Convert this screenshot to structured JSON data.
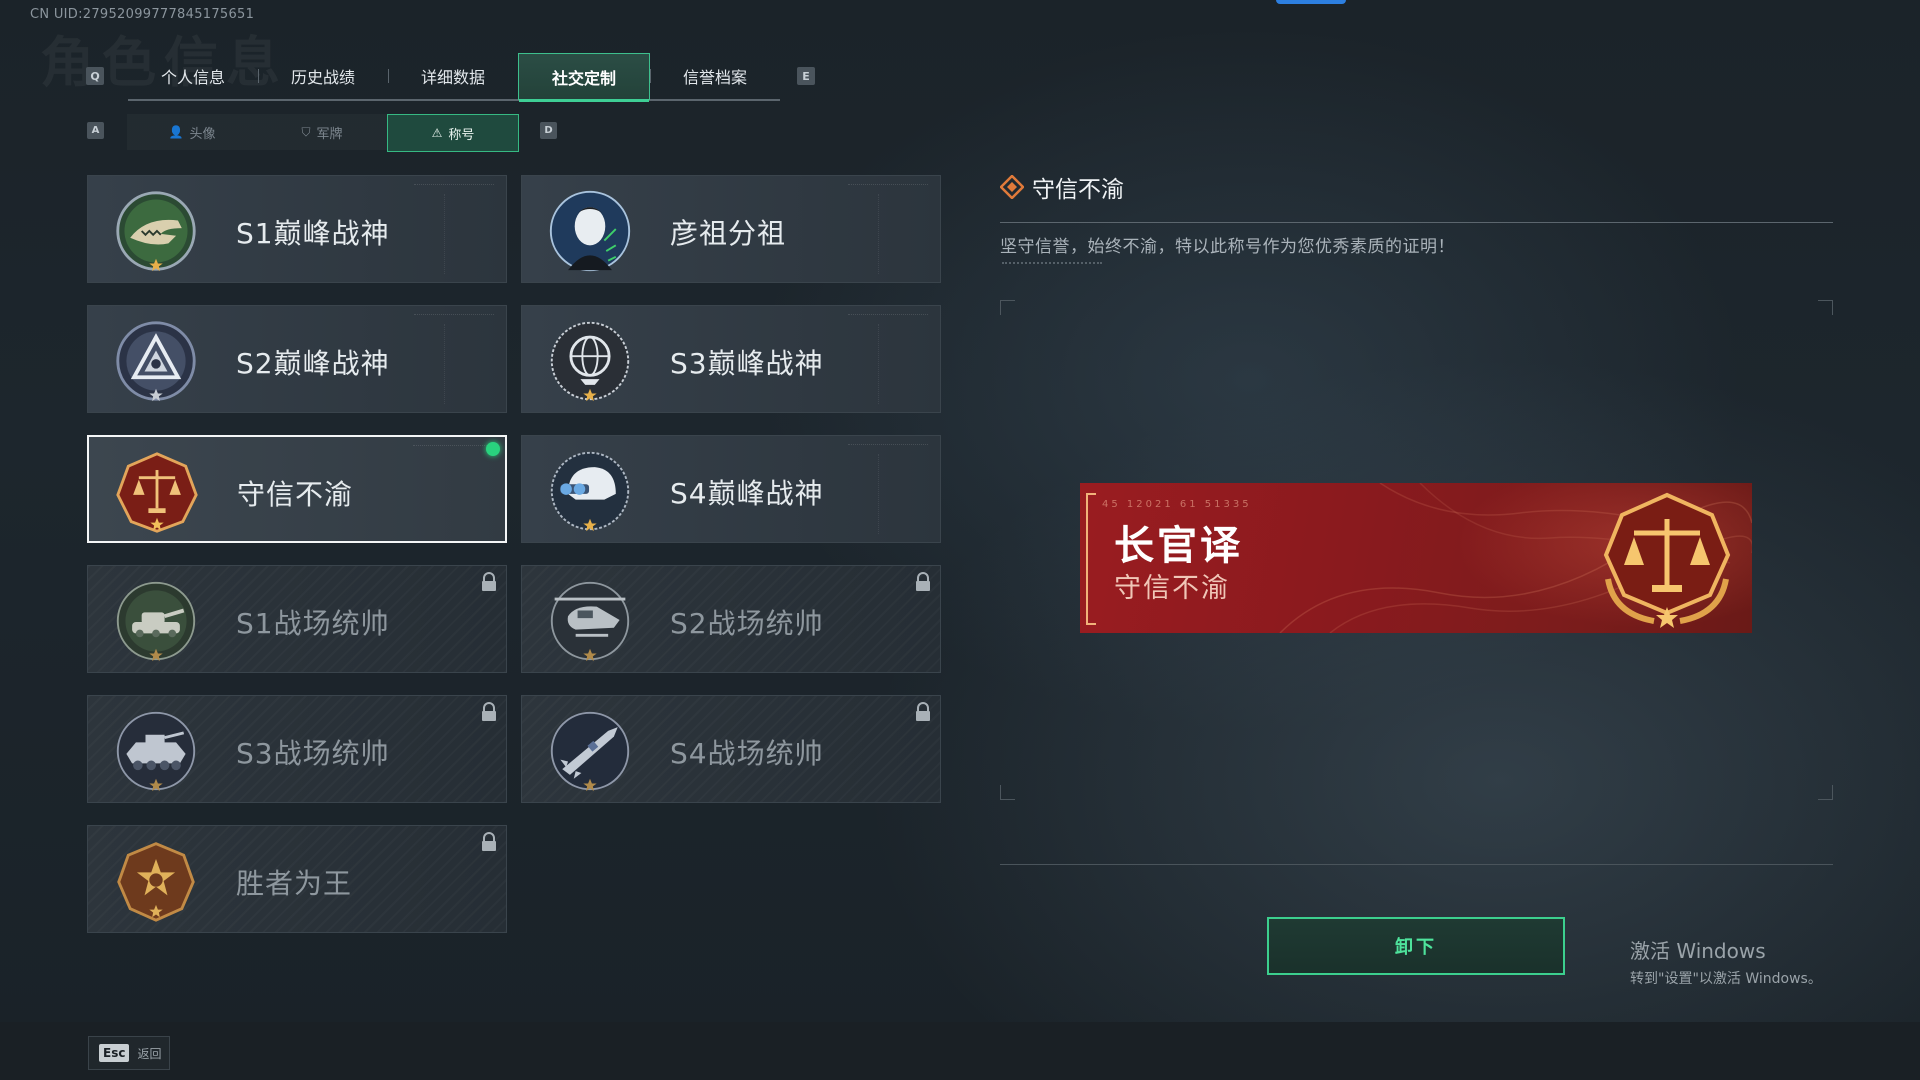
{
  "uid": "CN UID:27952099777845175651",
  "ghost_title": "角色信息",
  "main_tabs": {
    "left_key": "Q",
    "right_key": "E",
    "items": [
      {
        "label": "个人信息"
      },
      {
        "label": "历史战绩"
      },
      {
        "label": "详细数据"
      },
      {
        "label": "社交定制"
      },
      {
        "label": "信誉档案"
      }
    ],
    "active_index": 3
  },
  "sub_tabs": {
    "left_key": "A",
    "right_key": "D",
    "items": [
      {
        "label": "头像",
        "icon": "person-icon"
      },
      {
        "label": "军牌",
        "icon": "dogtag-icon"
      },
      {
        "label": "称号",
        "icon": "title-icon"
      }
    ],
    "active_index": 2
  },
  "titles": [
    {
      "label": "S1巅峰战神",
      "icon": "crocodile-emblem",
      "locked": false
    },
    {
      "label": "彦祖分祖",
      "icon": "portrait-emblem",
      "locked": false
    },
    {
      "label": "S2巅峰战神",
      "icon": "triangle-emblem",
      "locked": false
    },
    {
      "label": "S3巅峰战神",
      "icon": "globe-emblem",
      "locked": false
    },
    {
      "label": "守信不渝",
      "icon": "scales-emblem",
      "locked": false,
      "selected": true,
      "equipped": true
    },
    {
      "label": "S4巅峰战神",
      "icon": "helmet-emblem",
      "locked": false
    },
    {
      "label": "S1战场统帅",
      "icon": "tank-emblem",
      "locked": true
    },
    {
      "label": "S2战场统帅",
      "icon": "helicopter-emblem",
      "locked": true
    },
    {
      "label": "S3战场统帅",
      "icon": "armored-vehicle-emblem",
      "locked": true
    },
    {
      "label": "S4战场统帅",
      "icon": "missile-emblem",
      "locked": true
    },
    {
      "label": "胜者为王",
      "icon": "winner-medal-emblem",
      "locked": true
    }
  ],
  "detail": {
    "title": "守信不渝",
    "description": "坚守信誉，始终不渝，特以此称号作为您优秀素质的证明！"
  },
  "nameplate": {
    "player_name": "长官译",
    "title": "守信不渝",
    "code": "45 12021 61 51335",
    "color": "#8a1a1e"
  },
  "actions": {
    "unequip_label": "卸下"
  },
  "windows_activation": {
    "line1": "激活 Windows",
    "line2": "转到\"设置\"以激活 Windows。"
  },
  "footer": {
    "esc_key": "Esc",
    "esc_label": "返回"
  },
  "colors": {
    "accent_green": "#3ecf95",
    "equipped_dot": "#29d37e",
    "nameplate_red": "#8a1a1e"
  }
}
